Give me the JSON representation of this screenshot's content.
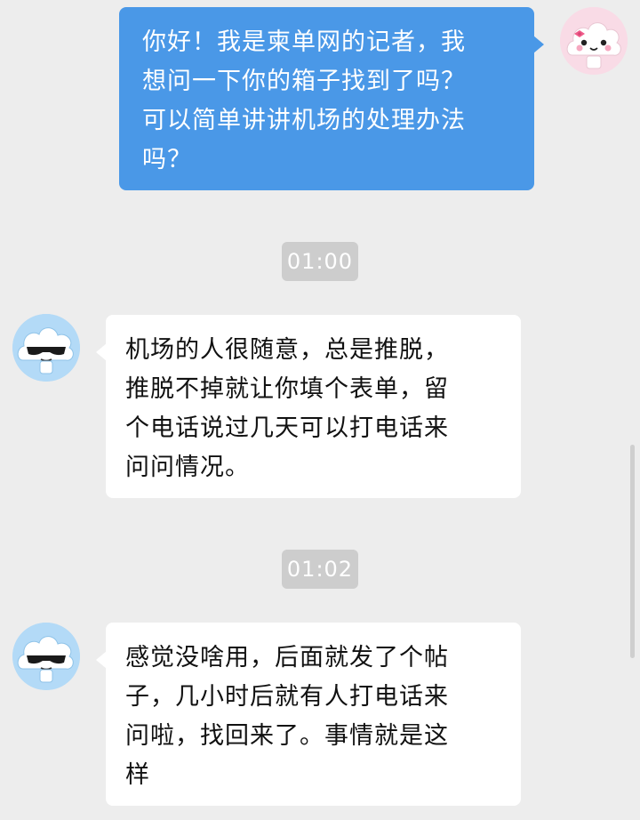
{
  "messages": [
    {
      "direction": "outgoing",
      "sender": "reporter",
      "lines": [
        "你好！我是柬单网的记者，我",
        "想问一下你的箱子找到了吗？",
        "可以简单讲讲机场的处理办法",
        "吗？"
      ]
    },
    {
      "direction": "incoming",
      "sender": "interviewee",
      "lines": [
        "机场的人很随意，总是推脱，",
        "推脱不掉就让你填个表单，留",
        "个电话说过几天可以打电话来",
        "问问情况。"
      ]
    },
    {
      "direction": "incoming",
      "sender": "interviewee",
      "lines": [
        "感觉没啥用，后面就发了个帖",
        "子，几小时后就有人打电话来",
        "问啦，找回来了。事情就是这",
        "样"
      ]
    }
  ],
  "timestamps": [
    "01:00",
    "01:02"
  ],
  "avatars": {
    "reporter": {
      "icon": "pink-cloud-girl-avatar-icon",
      "background": "#f9dbe6"
    },
    "interviewee": {
      "icon": "cloud-sunglasses-avatar-icon",
      "background": "#b3daf7"
    }
  },
  "colors": {
    "background": "#ededed",
    "outgoing_bubble": "#4a98e7",
    "incoming_bubble": "#ffffff",
    "timestamp_pill": "#cdcdcd"
  }
}
